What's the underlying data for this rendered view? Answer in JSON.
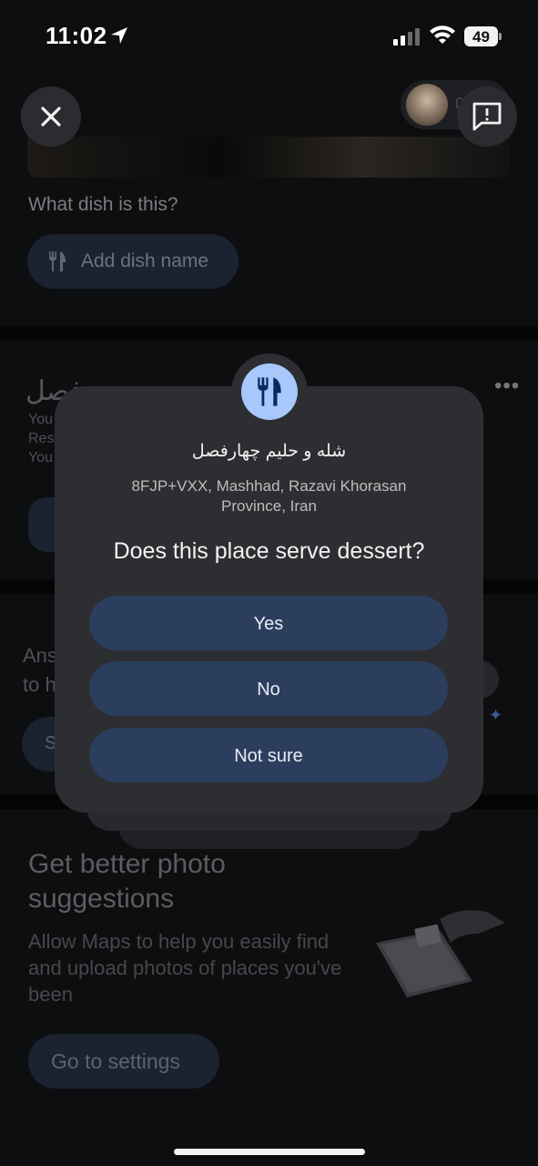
{
  "status_bar": {
    "time": "11:02",
    "battery": "49"
  },
  "background": {
    "avatar_count": "000",
    "dish_question": "What dish is this?",
    "add_dish_label": "Add dish name",
    "card_title_rtl": "فصل",
    "card_lines": [
      "You",
      "Res",
      "You"
    ],
    "more_label": "•••",
    "answer_prompt_lines": [
      "Ans",
      "to h"
    ],
    "s_button_letter": "S"
  },
  "promo": {
    "title_line1": "Get better photo",
    "title_line2": "suggestions",
    "text": "Allow Maps to help you easily find and upload photos of places you've been",
    "button_label": "Go to settings"
  },
  "dialog": {
    "place_name": "شله و حلیم چهارفصل",
    "address_line1": "8FJP+VXX, Mashhad, Razavi Khorasan",
    "address_line2": "Province, Iran",
    "question": "Does this place serve dessert?",
    "answers": [
      "Yes",
      "No",
      "Not sure"
    ],
    "accent_color": "#a8c7fa",
    "button_color": "#2c3e5e"
  }
}
